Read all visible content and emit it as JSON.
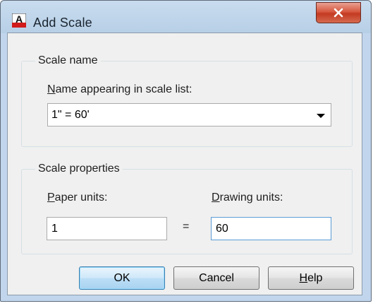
{
  "window": {
    "title": "Add Scale",
    "app_icon_letter": "A"
  },
  "scale_name_group": {
    "title": "Scale name",
    "combo_label_underlined": "N",
    "combo_label_rest": "ame appearing in scale list:",
    "combo_value": "1\" = 60'"
  },
  "scale_properties_group": {
    "title": "Scale properties",
    "paper_label_underlined": "P",
    "paper_label_rest": "aper units:",
    "drawing_label_underlined": "D",
    "drawing_label_rest": "rawing units:",
    "paper_value": "1",
    "equals": "=",
    "drawing_value": "60"
  },
  "buttons": {
    "ok": "OK",
    "cancel": "Cancel",
    "help_underlined": "H",
    "help_rest": "elp"
  },
  "colors": {
    "close_button": "#c33a22",
    "default_button": "#a9d3f1",
    "focus_border": "#5b9bd5"
  }
}
